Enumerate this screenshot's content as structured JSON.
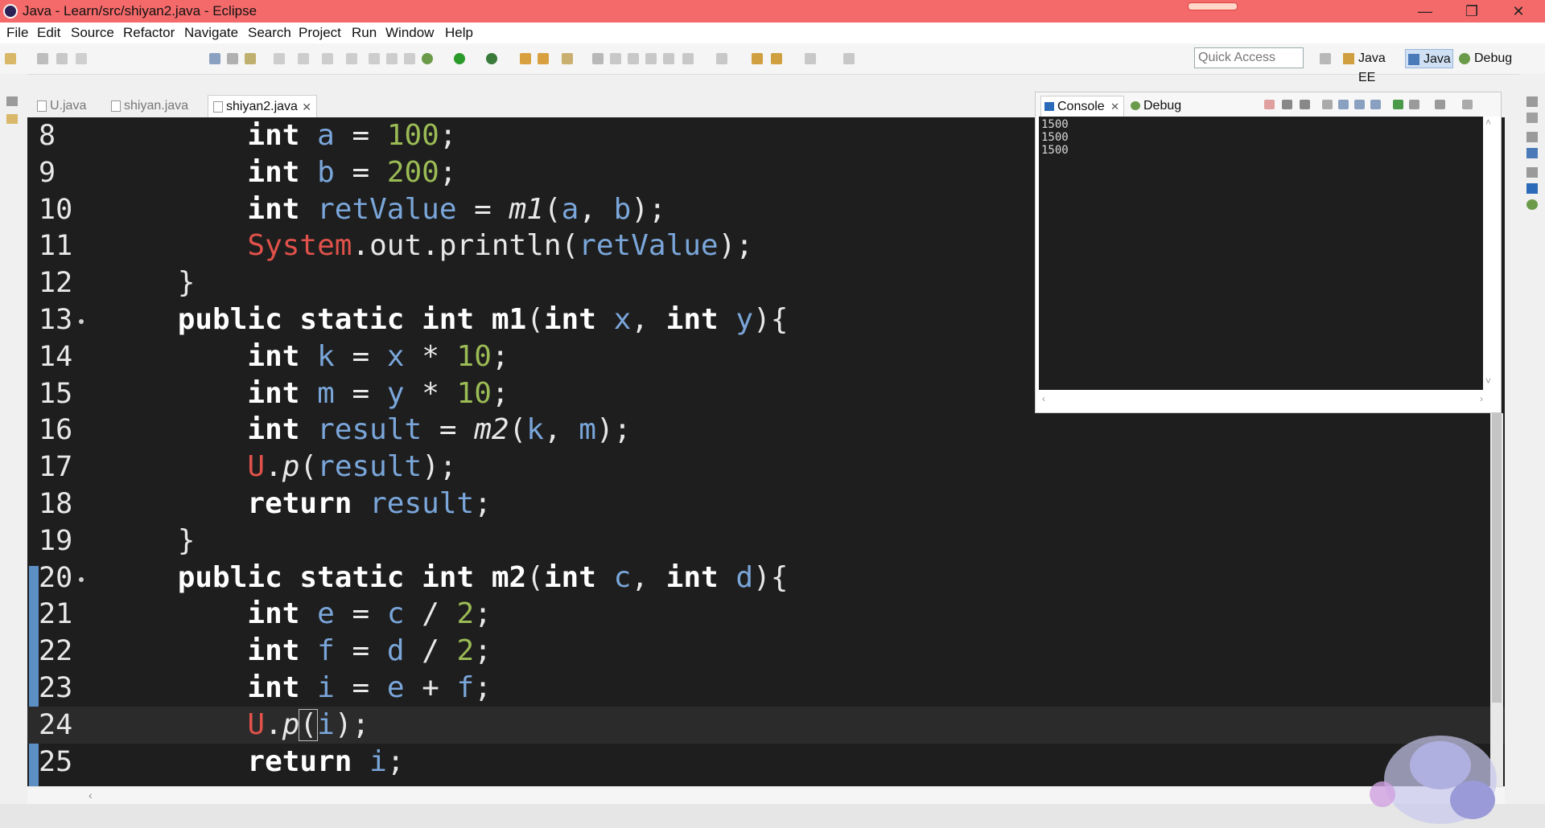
{
  "window": {
    "title": "Java - Learn/src/shiyan2.java - Eclipse",
    "minimize_glyph": "—",
    "maximize_glyph": "❐",
    "close_glyph": "✕"
  },
  "menu": [
    "File",
    "Edit",
    "Source",
    "Refactor",
    "Navigate",
    "Search",
    "Project",
    "Run",
    "Window",
    "Help"
  ],
  "toolbar": {
    "quick_access_placeholder": "Quick Access",
    "perspectives": [
      {
        "label": "Java EE",
        "active": false
      },
      {
        "label": "Java",
        "active": true
      },
      {
        "label": "Debug",
        "active": false
      }
    ]
  },
  "editor": {
    "tabs": [
      {
        "label": "U.java",
        "active": false
      },
      {
        "label": "shiyan.java",
        "active": false
      },
      {
        "label": "shiyan2.java",
        "active": true
      }
    ],
    "tab_close_glyph": "✕",
    "current_line": 24,
    "lines": [
      {
        "n": "8",
        "tokens": [
          [
            "        ",
            ""
          ],
          [
            "int",
            "kw"
          ],
          [
            " ",
            ""
          ],
          [
            "a",
            "var"
          ],
          [
            " = ",
            ""
          ],
          [
            "100",
            "num"
          ],
          [
            ";",
            ""
          ]
        ]
      },
      {
        "n": "9",
        "tokens": [
          [
            "        ",
            ""
          ],
          [
            "int",
            "kw"
          ],
          [
            " ",
            ""
          ],
          [
            "b",
            "var"
          ],
          [
            " = ",
            ""
          ],
          [
            "200",
            "num"
          ],
          [
            ";",
            ""
          ]
        ]
      },
      {
        "n": "10",
        "tokens": [
          [
            "        ",
            ""
          ],
          [
            "int",
            "kw"
          ],
          [
            " ",
            ""
          ],
          [
            "retValue",
            "var"
          ],
          [
            " = ",
            ""
          ],
          [
            "m1",
            "mth"
          ],
          [
            "(",
            ""
          ],
          [
            "a",
            "var"
          ],
          [
            ", ",
            ""
          ],
          [
            "b",
            "var"
          ],
          [
            ");",
            ""
          ]
        ]
      },
      {
        "n": "11",
        "tokens": [
          [
            "        ",
            ""
          ],
          [
            "System",
            "cls"
          ],
          [
            ".out.println(",
            ""
          ],
          [
            "retValue",
            "var"
          ],
          [
            ");",
            ""
          ]
        ]
      },
      {
        "n": "12",
        "tokens": [
          [
            "    }",
            ""
          ]
        ]
      },
      {
        "n": "13",
        "fold": true,
        "tokens": [
          [
            "    ",
            ""
          ],
          [
            "public static int m1",
            "kw"
          ],
          [
            "(",
            ""
          ],
          [
            "int",
            "kw"
          ],
          [
            " ",
            ""
          ],
          [
            "x",
            "var"
          ],
          [
            ", ",
            ""
          ],
          [
            "int",
            "kw"
          ],
          [
            " ",
            ""
          ],
          [
            "y",
            "var"
          ],
          [
            "){",
            ""
          ]
        ]
      },
      {
        "n": "14",
        "tokens": [
          [
            "        ",
            ""
          ],
          [
            "int",
            "kw"
          ],
          [
            " ",
            ""
          ],
          [
            "k",
            "var"
          ],
          [
            " = ",
            ""
          ],
          [
            "x",
            "var"
          ],
          [
            " * ",
            ""
          ],
          [
            "10",
            "num"
          ],
          [
            ";",
            ""
          ]
        ]
      },
      {
        "n": "15",
        "tokens": [
          [
            "        ",
            ""
          ],
          [
            "int",
            "kw"
          ],
          [
            " ",
            ""
          ],
          [
            "m",
            "var"
          ],
          [
            " = ",
            ""
          ],
          [
            "y",
            "var"
          ],
          [
            " * ",
            ""
          ],
          [
            "10",
            "num"
          ],
          [
            ";",
            ""
          ]
        ]
      },
      {
        "n": "16",
        "tokens": [
          [
            "        ",
            ""
          ],
          [
            "int",
            "kw"
          ],
          [
            " ",
            ""
          ],
          [
            "result",
            "var"
          ],
          [
            " = ",
            ""
          ],
          [
            "m2",
            "mth"
          ],
          [
            "(",
            ""
          ],
          [
            "k",
            "var"
          ],
          [
            ", ",
            ""
          ],
          [
            "m",
            "var"
          ],
          [
            ");",
            ""
          ]
        ]
      },
      {
        "n": "17",
        "tokens": [
          [
            "        ",
            ""
          ],
          [
            "U",
            "cls"
          ],
          [
            ".",
            ""
          ],
          [
            "p",
            "mth"
          ],
          [
            "(",
            ""
          ],
          [
            "result",
            "var"
          ],
          [
            ");",
            ""
          ]
        ]
      },
      {
        "n": "18",
        "tokens": [
          [
            "        ",
            ""
          ],
          [
            "return",
            "kw"
          ],
          [
            " ",
            ""
          ],
          [
            "result",
            "var"
          ],
          [
            ";",
            ""
          ]
        ]
      },
      {
        "n": "19",
        "tokens": [
          [
            "    }",
            ""
          ]
        ]
      },
      {
        "n": "20",
        "fold": true,
        "tokens": [
          [
            "    ",
            ""
          ],
          [
            "public static int m2",
            "kw"
          ],
          [
            "(",
            ""
          ],
          [
            "int",
            "kw"
          ],
          [
            " ",
            ""
          ],
          [
            "c",
            "var"
          ],
          [
            ", ",
            ""
          ],
          [
            "int",
            "kw"
          ],
          [
            " ",
            ""
          ],
          [
            "d",
            "var"
          ],
          [
            "){",
            ""
          ]
        ]
      },
      {
        "n": "21",
        "tokens": [
          [
            "        ",
            ""
          ],
          [
            "int",
            "kw"
          ],
          [
            " ",
            ""
          ],
          [
            "e",
            "var"
          ],
          [
            " = ",
            ""
          ],
          [
            "c",
            "var"
          ],
          [
            " / ",
            ""
          ],
          [
            "2",
            "num"
          ],
          [
            ";",
            ""
          ]
        ]
      },
      {
        "n": "22",
        "tokens": [
          [
            "        ",
            ""
          ],
          [
            "int",
            "kw"
          ],
          [
            " ",
            ""
          ],
          [
            "f",
            "var"
          ],
          [
            " = ",
            ""
          ],
          [
            "d",
            "var"
          ],
          [
            " / ",
            ""
          ],
          [
            "2",
            "num"
          ],
          [
            ";",
            ""
          ]
        ]
      },
      {
        "n": "23",
        "tokens": [
          [
            "        ",
            ""
          ],
          [
            "int",
            "kw"
          ],
          [
            " ",
            ""
          ],
          [
            "i",
            "var"
          ],
          [
            " = ",
            ""
          ],
          [
            "e",
            "var"
          ],
          [
            " + ",
            ""
          ],
          [
            "f",
            "var"
          ],
          [
            ";",
            ""
          ]
        ]
      },
      {
        "n": "24",
        "tokens": [
          [
            "        ",
            ""
          ],
          [
            "U",
            "cls"
          ],
          [
            ".",
            ""
          ],
          [
            "p",
            "mth"
          ],
          [
            "(",
            "cursor"
          ],
          [
            "i",
            "var"
          ],
          [
            ");",
            ""
          ]
        ]
      },
      {
        "n": "25",
        "tokens": [
          [
            "        ",
            ""
          ],
          [
            "return",
            "kw"
          ],
          [
            " ",
            ""
          ],
          [
            "i",
            "var"
          ],
          [
            ";",
            ""
          ]
        ]
      }
    ]
  },
  "console": {
    "tabs": [
      {
        "label": "Console",
        "active": true
      },
      {
        "label": "Debug",
        "active": false
      }
    ],
    "tab_close_glyph": "✕",
    "output": [
      "1500",
      "1500",
      "1500"
    ]
  },
  "colors": {
    "titlebar": "#f46a6a",
    "editor_bg": "#1e1e1e",
    "keyword": "#ffffff",
    "variable": "#7aa6da",
    "number": "#9bbb55",
    "class": "#e0524a",
    "perspective_active": "#cfe0f5"
  }
}
